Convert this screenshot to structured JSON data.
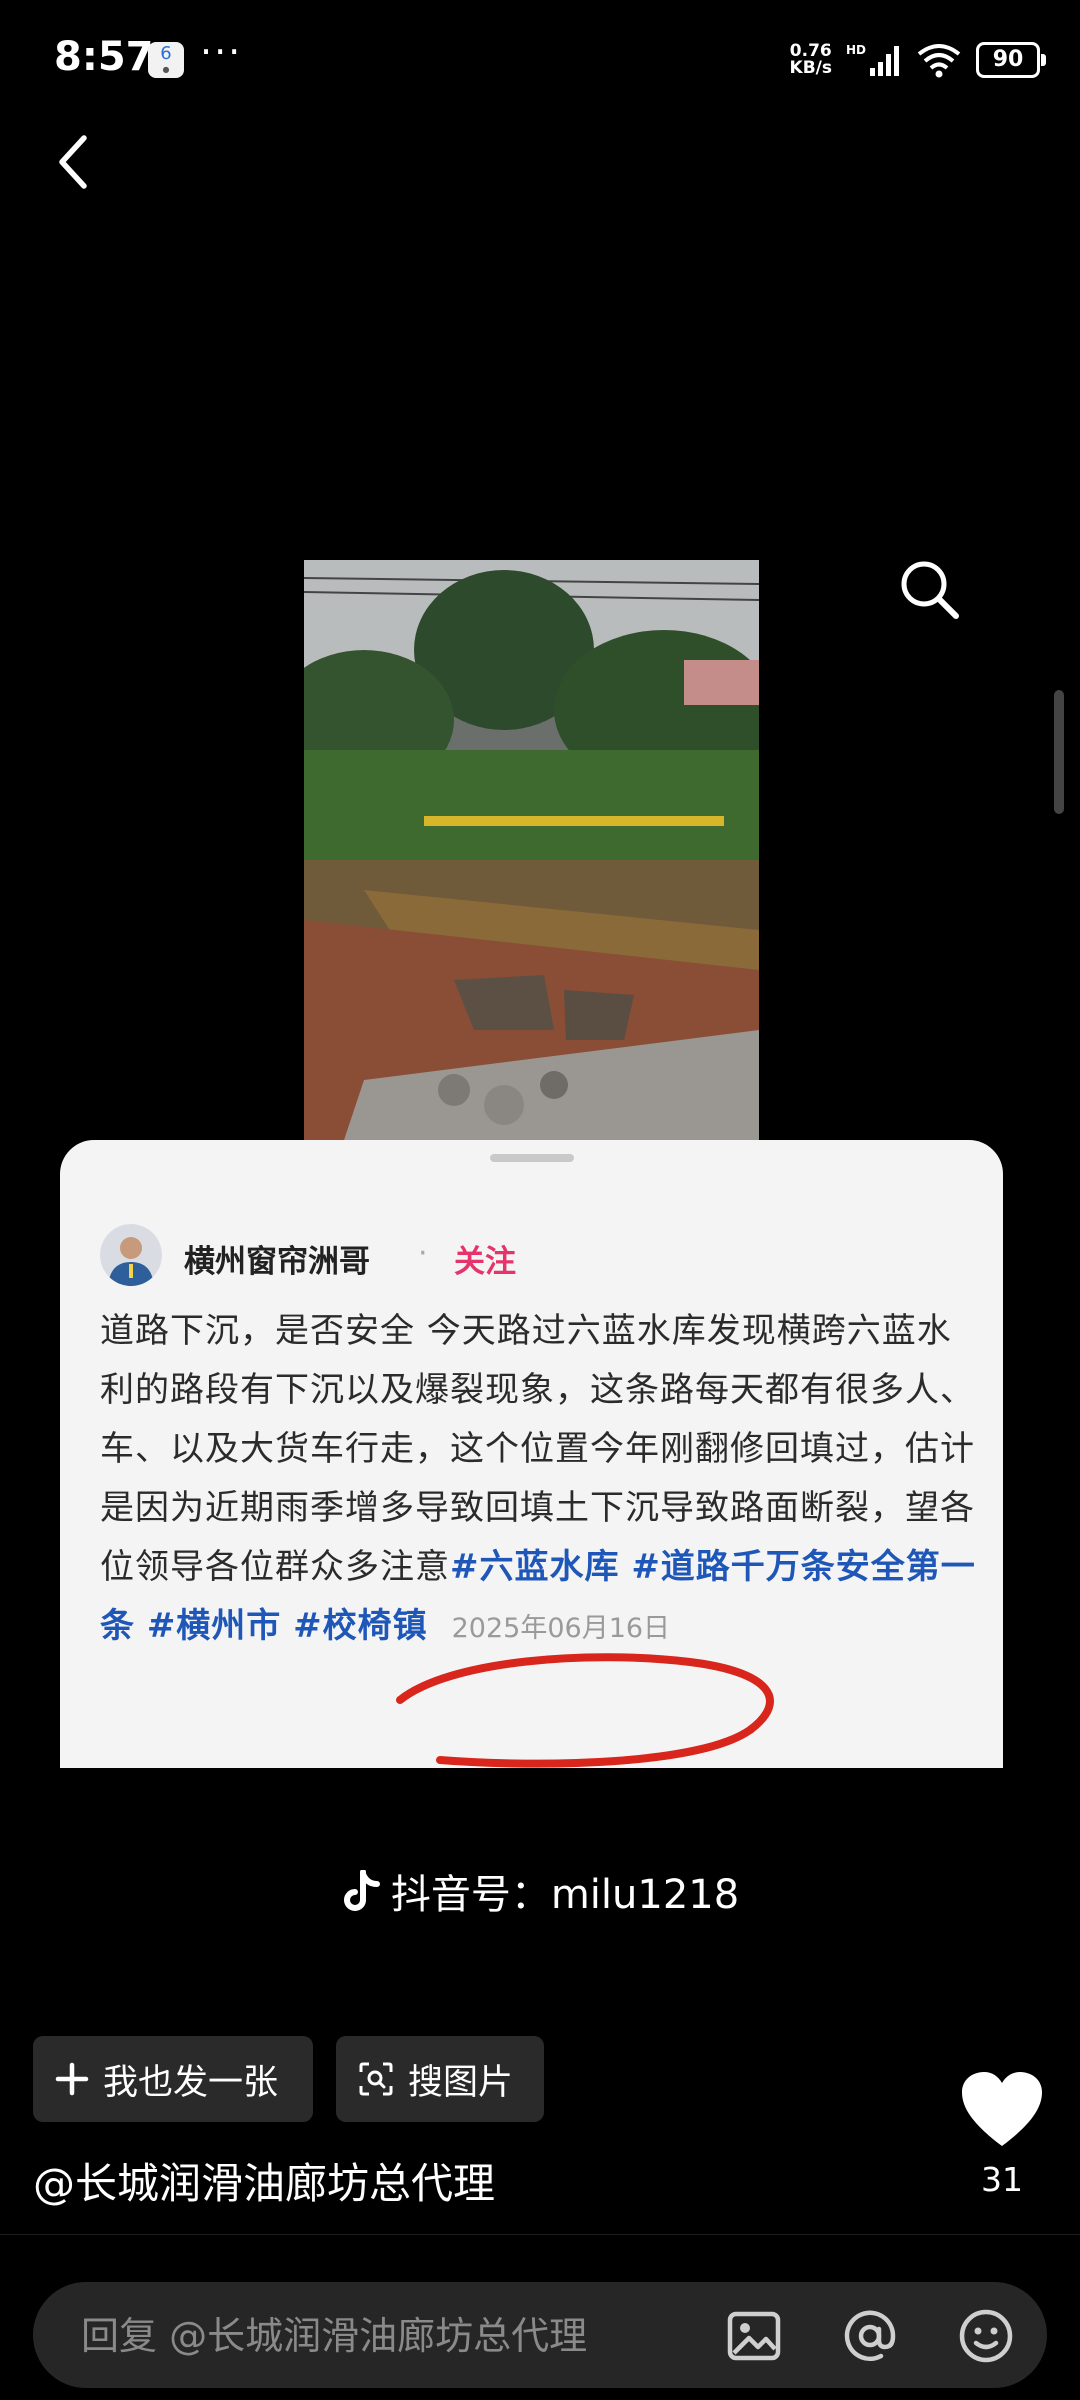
{
  "status_bar": {
    "time": "8:57",
    "app_badge": "6",
    "more_dots": "···",
    "net_speed_value": "0.76",
    "net_speed_unit": "KB/s",
    "battery": "90"
  },
  "viewer": {
    "douyin_label": "抖音号：",
    "douyin_id": "milu1218"
  },
  "card": {
    "author": "横州窗帘洲哥",
    "separator": "·",
    "follow_label": "关注",
    "text": "道路下沉，是否安全 今天路过六蓝水库发现横跨六蓝水利的路段有下沉以及爆裂现象，这条路每天都有很多人、车、以及大货车行走，这个位置今年刚翻修回填过，估计是因为近期雨季增多导致回填土下沉导致路面断裂，望各位领导各位群众多注意",
    "hashtags": [
      "#六蓝水库",
      "#道路千万条安全第一条",
      "#横州市",
      "#校椅镇"
    ],
    "date": "2025年06月16日"
  },
  "actions": {
    "post_label": "我也发一张",
    "search_label": "搜图片",
    "like_count": "31"
  },
  "author_mention": "@长城润滑油廊坊总代理",
  "reply": {
    "placeholder": "回复 @长城润滑油廊坊总代理"
  },
  "colors": {
    "background": "#000000",
    "follow": "#e6336b",
    "hashtag": "#1f57b8",
    "annotation": "#d8261c"
  },
  "icons": [
    "back-arrow-icon",
    "search-icon",
    "plus-icon",
    "scan-search-icon",
    "heart-icon",
    "image-icon",
    "at-icon",
    "emoji-icon",
    "douyin-icon"
  ]
}
